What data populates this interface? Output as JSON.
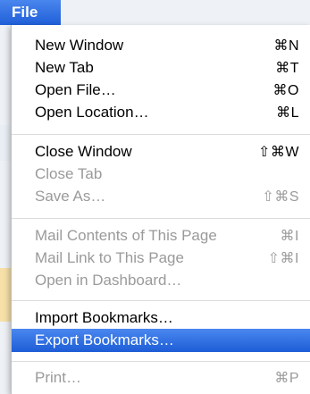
{
  "menu": {
    "title": "File",
    "items": [
      {
        "label": "New Window",
        "shortcut": "⌘N"
      },
      {
        "label": "New Tab",
        "shortcut": "⌘T"
      },
      {
        "label": "Open File…",
        "shortcut": "⌘O"
      },
      {
        "label": "Open Location…",
        "shortcut": "⌘L"
      },
      {
        "label": "Close Window",
        "shortcut": "⇧⌘W"
      },
      {
        "label": "Close Tab",
        "shortcut": ""
      },
      {
        "label": "Save As…",
        "shortcut": "⇧⌘S"
      },
      {
        "label": "Mail Contents of This Page",
        "shortcut": "⌘I"
      },
      {
        "label": "Mail Link to This Page",
        "shortcut": "⇧⌘I"
      },
      {
        "label": "Open in Dashboard…",
        "shortcut": ""
      },
      {
        "label": "Import Bookmarks…",
        "shortcut": ""
      },
      {
        "label": "Export Bookmarks…",
        "shortcut": ""
      },
      {
        "label": "Print…",
        "shortcut": "⌘P"
      }
    ]
  },
  "colors": {
    "highlight": "#2a6de3",
    "disabled_text": "#9a9a9a"
  }
}
